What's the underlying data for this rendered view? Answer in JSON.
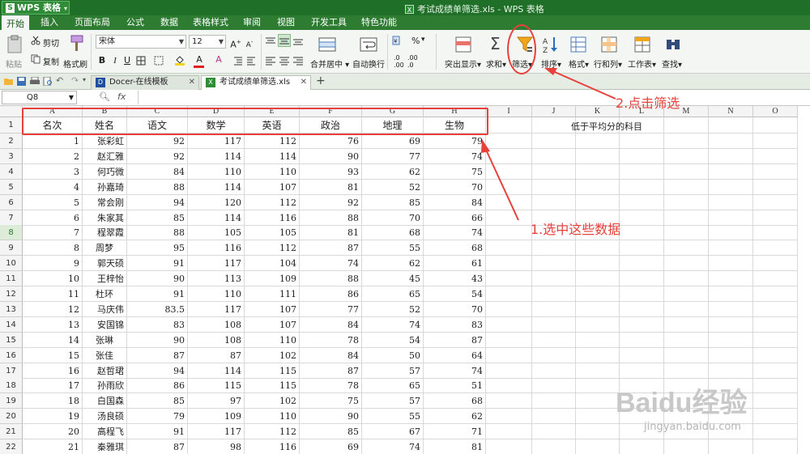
{
  "app": {
    "name": "WPS 表格",
    "window_title": "考试成绩单筛选.xls - WPS 表格"
  },
  "menu": [
    "开始",
    "插入",
    "页面布局",
    "公式",
    "数据",
    "表格样式",
    "审阅",
    "视图",
    "开发工具",
    "特色功能"
  ],
  "ribbon": {
    "paste": "粘贴",
    "cut": "剪切",
    "copy": "复制",
    "format_painter": "格式刷",
    "font_name": "宋体",
    "font_size": "12",
    "merge_center": "合并居中",
    "wrap_text": "自动换行",
    "highlight": "突出显示",
    "sum": "求和",
    "filter": "筛选",
    "sort": "排序",
    "format": "格式",
    "rows_cols": "行和列",
    "worksheet": "工作表",
    "find": "查找",
    "percent": "%"
  },
  "doc_tabs": [
    "Docer-在线模板",
    "考试成绩单筛选.xls"
  ],
  "formula_bar": {
    "cell_ref": "Q8",
    "fx": "fx"
  },
  "columns": [
    "A",
    "B",
    "C",
    "D",
    "E",
    "F",
    "G",
    "H",
    "I",
    "J",
    "K",
    "L",
    "M",
    "N",
    "O"
  ],
  "header_row": [
    "名次",
    "姓名",
    "语文",
    "数学",
    "英语",
    "政治",
    "地理",
    "生物"
  ],
  "side_note": "低于平均分的科目",
  "rows": [
    [
      "1",
      "张彩虹",
      "92",
      "117",
      "112",
      "76",
      "69",
      "79"
    ],
    [
      "2",
      "赵汇雅",
      "92",
      "114",
      "114",
      "90",
      "77",
      "74"
    ],
    [
      "3",
      "何巧微",
      "84",
      "110",
      "110",
      "93",
      "62",
      "75"
    ],
    [
      "4",
      "孙嘉琦",
      "88",
      "114",
      "107",
      "81",
      "52",
      "70"
    ],
    [
      "5",
      "常会刚",
      "94",
      "120",
      "112",
      "92",
      "85",
      "84"
    ],
    [
      "6",
      "朱家其",
      "85",
      "114",
      "116",
      "88",
      "70",
      "66"
    ],
    [
      "7",
      "程翠霞",
      "88",
      "105",
      "105",
      "81",
      "68",
      "74"
    ],
    [
      "8",
      "周梦",
      "95",
      "116",
      "112",
      "87",
      "55",
      "68"
    ],
    [
      "9",
      "郭天硕",
      "91",
      "117",
      "104",
      "74",
      "62",
      "61"
    ],
    [
      "10",
      "王梓怡",
      "90",
      "113",
      "109",
      "88",
      "45",
      "43"
    ],
    [
      "11",
      "杜环",
      "91",
      "110",
      "111",
      "86",
      "65",
      "54"
    ],
    [
      "12",
      "马庆伟",
      "83.5",
      "117",
      "107",
      "77",
      "52",
      "70"
    ],
    [
      "13",
      "安国锦",
      "83",
      "108",
      "107",
      "84",
      "74",
      "83"
    ],
    [
      "14",
      "张琳",
      "90",
      "108",
      "110",
      "78",
      "54",
      "87"
    ],
    [
      "15",
      "张佳",
      "87",
      "87",
      "102",
      "84",
      "50",
      "64"
    ],
    [
      "16",
      "赵哲珺",
      "94",
      "114",
      "115",
      "87",
      "57",
      "74"
    ],
    [
      "17",
      "孙雨欣",
      "86",
      "115",
      "115",
      "78",
      "65",
      "51"
    ],
    [
      "18",
      "白国森",
      "85",
      "97",
      "102",
      "75",
      "57",
      "68"
    ],
    [
      "19",
      "汤良硕",
      "79",
      "109",
      "110",
      "90",
      "55",
      "62"
    ],
    [
      "20",
      "高程飞",
      "91",
      "117",
      "112",
      "85",
      "67",
      "71"
    ],
    [
      "21",
      "秦雅琪",
      "87",
      "98",
      "116",
      "69",
      "74",
      "81"
    ]
  ],
  "row_numbers": [
    "1",
    "2",
    "3",
    "4",
    "5",
    "6",
    "7",
    "8",
    "9",
    "10",
    "11",
    "12",
    "13",
    "14",
    "15",
    "16",
    "17",
    "18",
    "19",
    "20",
    "21",
    "22"
  ],
  "annotations": {
    "step1": "1.选中这些数据",
    "step2": "2.点击筛选"
  },
  "watermark": {
    "brand": "Baidu经验",
    "url": "jingyan.baidu.com"
  },
  "colors": {
    "accent": "#e8413b",
    "app_green": "#2d7c32"
  }
}
